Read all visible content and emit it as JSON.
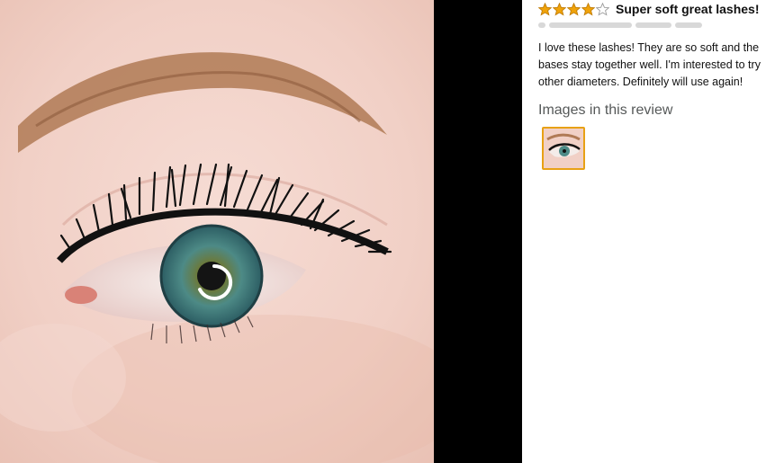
{
  "viewer": {
    "photo_icon": "eye-closeup-photo",
    "spinner_icon": "loading-spinner-icon"
  },
  "review": {
    "rating": 4,
    "rating_max": 5,
    "star_color": "#f0a30a",
    "title": "Super soft great lashes!",
    "body": "I love these lashes! They are so soft and the bases stay together well. I'm interested to try other diameters. Definitely will use again!",
    "images_heading": "Images in this review",
    "thumbnail_count": 1,
    "thumbnail_border_color": "#e8a115"
  }
}
